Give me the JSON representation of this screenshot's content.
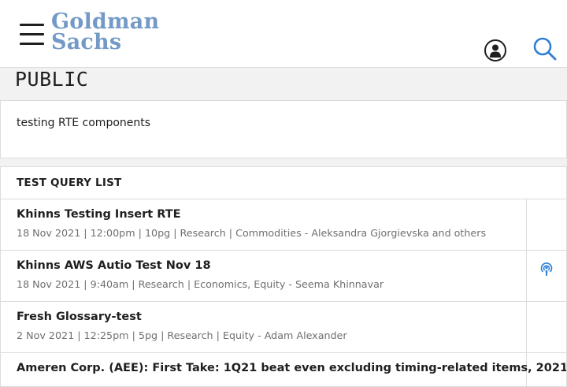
{
  "header": {
    "logo_line1": "Goldman",
    "logo_line2": "Sachs"
  },
  "page": {
    "title": "PUBLIC"
  },
  "rte": {
    "text": "testing RTE components"
  },
  "list": {
    "heading": "TEST QUERY LIST",
    "items": [
      {
        "title": "Khinns Testing Insert RTE",
        "date": "18 Nov 2021",
        "time": "12:00pm",
        "pages": "10pg",
        "category": "Research | Commodities",
        "authors": "Aleksandra Gjorgievska and others",
        "icon": ""
      },
      {
        "title": "Khinns AWS Autio Test Nov 18",
        "date": "18 Nov 2021",
        "time": "9:40am",
        "pages": "",
        "category": "Research | Economics, Equity",
        "authors": "Seema Khinnavar",
        "icon": "podcast-icon"
      },
      {
        "title": "Fresh Glossary-test",
        "date": "2 Nov 2021",
        "time": "12:25pm",
        "pages": "5pg",
        "category": "Research | Equity",
        "authors": "Adam Alexander",
        "icon": ""
      },
      {
        "title": "Ameren Corp. (AEE): First Take: 1Q21 beat even excluding timing-related items, 2021",
        "date": "",
        "time": "",
        "pages": "",
        "category": "",
        "authors": "",
        "icon": ""
      }
    ]
  },
  "colors": {
    "brand": "#7399c6",
    "search_icon": "#2f7fd4",
    "text": "#1f1f1f",
    "meta": "#6f6f6f",
    "border": "#dcdcdc",
    "background": "#f2f2f2"
  }
}
